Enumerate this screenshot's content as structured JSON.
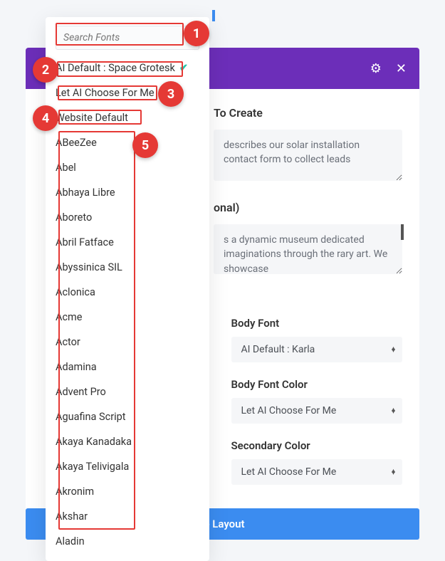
{
  "header": {
    "settings_icon": "⚙",
    "close_icon": "✕"
  },
  "form": {
    "section1_heading_partial": "To Create",
    "section1_text": "describes our solar installation contact form to collect leads",
    "section2_heading_partial": "onal)",
    "section2_text": "s a dynamic museum dedicated imaginations through the rary art. We showcase",
    "body_font_label": "Body Font",
    "body_font_value": "AI Default : Karla",
    "body_font_color_label": "Body Font Color",
    "body_font_color_value": "Let AI Choose For Me",
    "secondary_color_label": "Secondary Color",
    "secondary_color_value": "Let AI Choose For Me"
  },
  "bottom_button_partial": "te Layout",
  "fontpicker": {
    "search_placeholder": "Search Fonts",
    "ai_default": "AI Default : Space Grotesk",
    "let_ai": "Let AI Choose For Me",
    "website_default": "Website Default",
    "fonts": [
      "ABeeZee",
      "Abel",
      "Abhaya Libre",
      "Aboreto",
      "Abril Fatface",
      "Abyssinica SIL",
      "Aclonica",
      "Acme",
      "Actor",
      "Adamina",
      "Advent Pro",
      "Aguafina Script",
      "Akaya Kanadaka",
      "Akaya Telivigala",
      "Akronim",
      "Akshar",
      "Aladin"
    ]
  },
  "annotations": {
    "b1": "1",
    "b2": "2",
    "b3": "3",
    "b4": "4",
    "b5": "5"
  }
}
